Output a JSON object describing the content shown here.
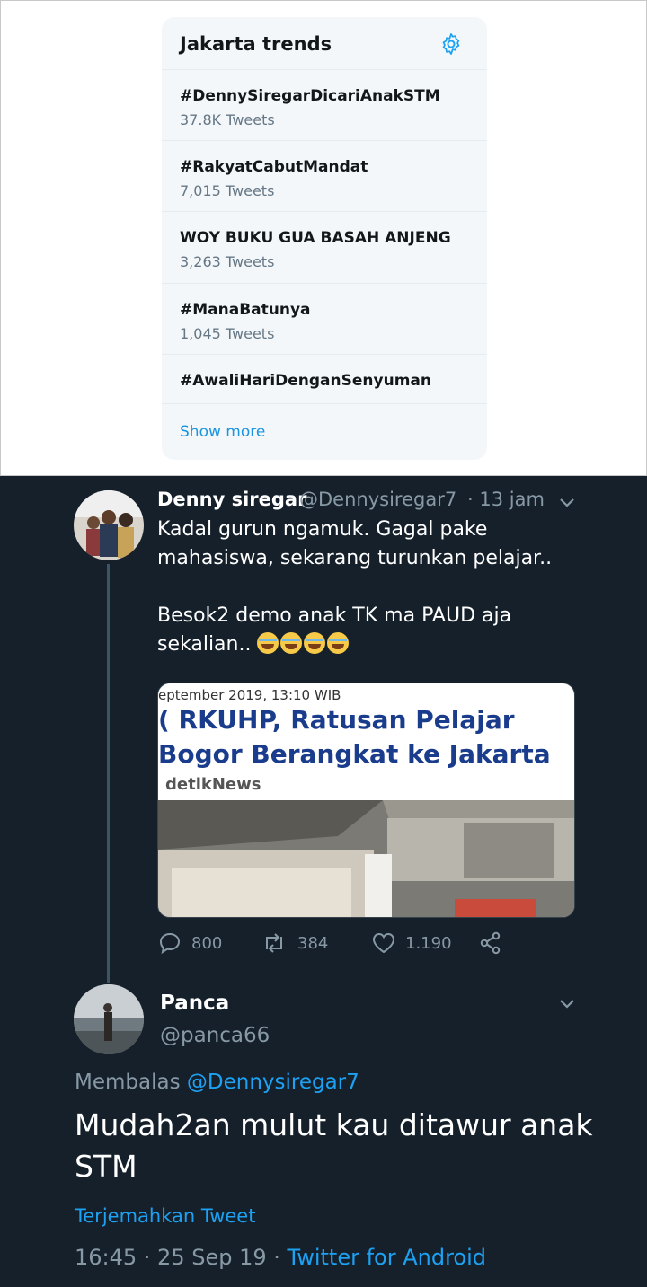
{
  "trends": {
    "title": "Jakarta trends",
    "settings_icon": "gear-icon",
    "items": [
      {
        "name": "#DennySiregarDicariAnakSTM",
        "count": "37.8K Tweets"
      },
      {
        "name": "#RakyatCabutMandat",
        "count": "7,015 Tweets"
      },
      {
        "name": "WOY BUKU GUA BASAH ANJENG",
        "count": "3,263 Tweets"
      },
      {
        "name": "#ManaBatunya",
        "count": "1,045 Tweets"
      },
      {
        "name": "#AwaliHariDenganSenyuman",
        "count": ""
      }
    ],
    "show_more": "Show more"
  },
  "tweet1": {
    "name": "Denny siregar",
    "handle": "@Dennysiregar7",
    "time": "· 13 jam",
    "line1": "Kadal gurun ngamuk. Gagal pake mahasiswa, sekarang turunkan pelajar..",
    "line2": "Besok2 demo anak TK ma PAUD aja sekalian..",
    "emoji_count": 4,
    "media": {
      "date": "eptember 2019, 13:10 WIB",
      "headline1": "( RKUHP, Ratusan Pelajar",
      "headline2": "Bogor Berangkat ke Jakarta",
      "source": "detikNews"
    },
    "replies": "800",
    "retweets": "384",
    "likes": "1.190"
  },
  "tweet2": {
    "name": "Panca",
    "handle": "@panca66",
    "reply_prefix": "Membalas",
    "reply_to": "@Dennysiregar7",
    "text": "Mudah2an mulut kau ditawur anak STM",
    "translate": "Terjemahkan Tweet",
    "timestamp": "16:45 · 25 Sep 19 ·",
    "client": "Twitter for Android"
  },
  "colors": {
    "accent": "#1da1f2",
    "dark_bg": "#15202b",
    "muted": "#8899a6"
  }
}
